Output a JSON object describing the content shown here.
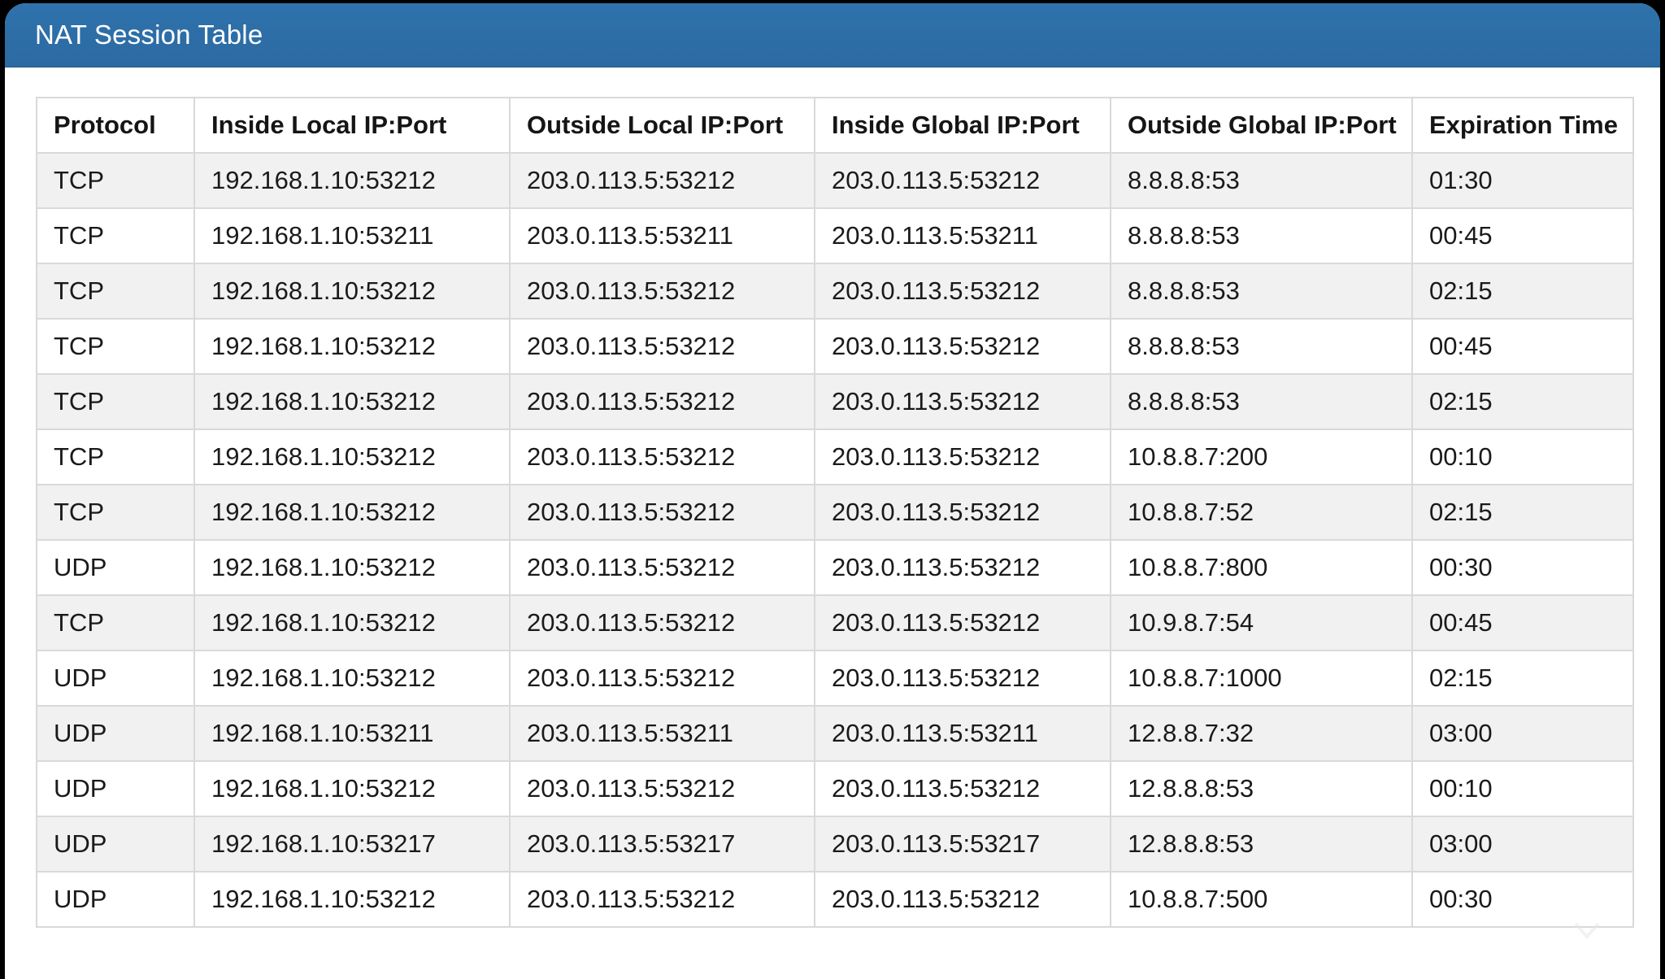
{
  "window": {
    "title": "NAT Session Table"
  },
  "colors": {
    "titlebar": "#2f72ac",
    "row_alt": "#f1f1f1",
    "border": "#d9d9d9"
  },
  "table": {
    "columns": [
      "Protocol",
      "Inside Local IP:Port",
      "Outside Local IP:Port",
      "Inside Global IP:Port",
      "Outside Global IP:Port",
      "Expiration Time"
    ],
    "rows": [
      [
        "TCP",
        "192.168.1.10:53212",
        "203.0.113.5:53212",
        "203.0.113.5:53212",
        "8.8.8.8:53",
        "01:30"
      ],
      [
        "TCP",
        "192.168.1.10:53211",
        "203.0.113.5:53211",
        "203.0.113.5:53211",
        "8.8.8.8:53",
        "00:45"
      ],
      [
        "TCP",
        "192.168.1.10:53212",
        "203.0.113.5:53212",
        "203.0.113.5:53212",
        "8.8.8.8:53",
        "02:15"
      ],
      [
        "TCP",
        "192.168.1.10:53212",
        "203.0.113.5:53212",
        "203.0.113.5:53212",
        "8.8.8.8:53",
        "00:45"
      ],
      [
        "TCP",
        "192.168.1.10:53212",
        "203.0.113.5:53212",
        "203.0.113.5:53212",
        "8.8.8.8:53",
        "02:15"
      ],
      [
        "TCP",
        "192.168.1.10:53212",
        "203.0.113.5:53212",
        "203.0.113.5:53212",
        "10.8.8.7:200",
        "00:10"
      ],
      [
        "TCP",
        "192.168.1.10:53212",
        "203.0.113.5:53212",
        "203.0.113.5:53212",
        "10.8.8.7:52",
        "02:15"
      ],
      [
        "UDP",
        "192.168.1.10:53212",
        "203.0.113.5:53212",
        "203.0.113.5:53212",
        "10.8.8.7:800",
        "00:30"
      ],
      [
        "TCP",
        "192.168.1.10:53212",
        "203.0.113.5:53212",
        "203.0.113.5:53212",
        "10.9.8.7:54",
        "00:45"
      ],
      [
        "UDP",
        "192.168.1.10:53212",
        "203.0.113.5:53212",
        "203.0.113.5:53212",
        "10.8.8.7:1000",
        "02:15"
      ],
      [
        "UDP",
        "192.168.1.10:53211",
        "203.0.113.5:53211",
        "203.0.113.5:53211",
        "12.8.8.7:32",
        "03:00"
      ],
      [
        "UDP",
        "192.168.1.10:53212",
        "203.0.113.5:53212",
        "203.0.113.5:53212",
        "12.8.8.8:53",
        "00:10"
      ],
      [
        "UDP",
        "192.168.1.10:53217",
        "203.0.113.5:53217",
        "203.0.113.5:53217",
        "12.8.8.8:53",
        "03:00"
      ],
      [
        "UDP",
        "192.168.1.10:53212",
        "203.0.113.5:53212",
        "203.0.113.5:53212",
        "10.8.8.7:500",
        "00:30"
      ]
    ]
  }
}
